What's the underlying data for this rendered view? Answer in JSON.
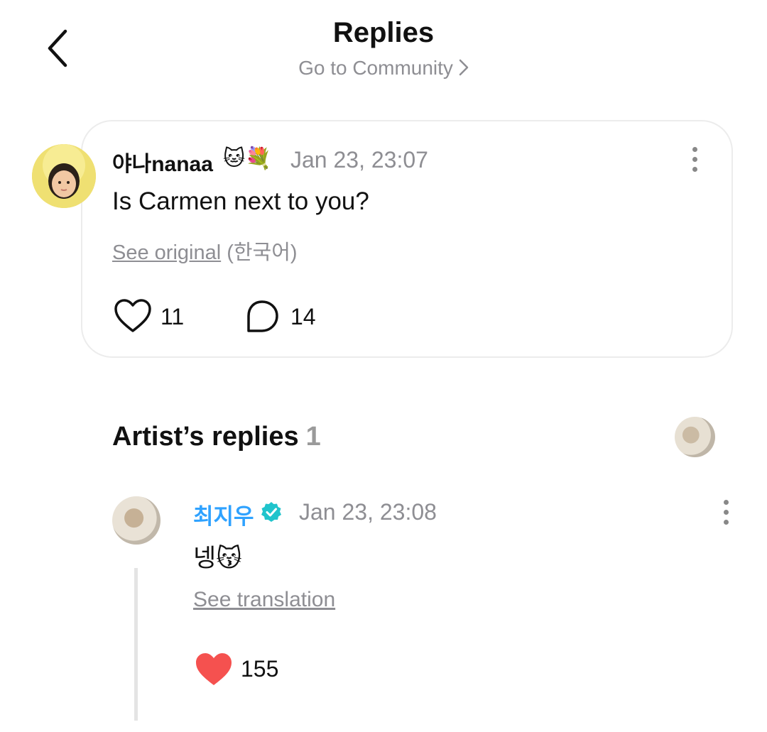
{
  "header": {
    "title": "Replies",
    "community_link": "Go to Community"
  },
  "post": {
    "username": "야나nanaa",
    "username_emoji": "🐱💐",
    "timestamp": "Jan 23, 23:07",
    "body": "Is Carmen next to you?",
    "see_original_label": "See original",
    "original_language": "(한국어)",
    "like_count": "11",
    "comment_count": "14"
  },
  "artist_replies": {
    "title": "Artist’s replies",
    "count": "1"
  },
  "reply": {
    "username": "최지우",
    "timestamp": "Jan 23, 23:08",
    "body": "넹😽",
    "see_translation_label": "See translation",
    "like_count": "155"
  },
  "colors": {
    "accent_blue": "#2fa2ff",
    "verified_teal": "#20c4cc",
    "heart_red": "#f5514f",
    "muted_gray": "#8e8e93"
  },
  "icons": {
    "back": "chevron-left-icon",
    "community_chevron": "chevron-right-icon",
    "post_menu": "more-vertical-icon",
    "post_like": "heart-outline-icon",
    "post_comment": "comment-bubble-icon",
    "verified": "verified-badge-icon",
    "reply_menu": "more-vertical-icon",
    "reply_like": "heart-filled-icon"
  }
}
